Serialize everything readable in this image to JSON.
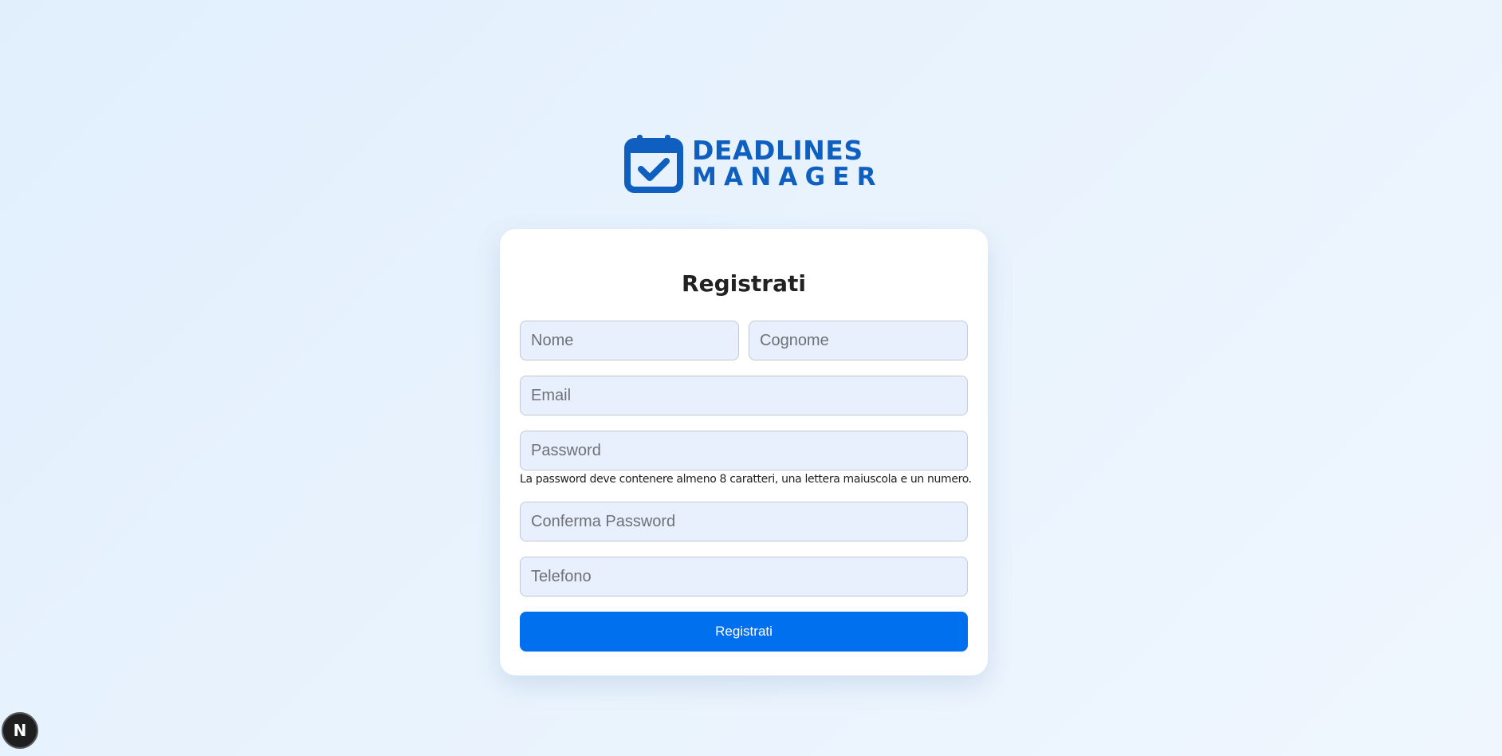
{
  "brand": {
    "line1": "DEADLINES",
    "line2": "MANAGER",
    "icon": "calendar-check-icon",
    "color": "#0e5fc0"
  },
  "form": {
    "title": "Registrati",
    "fields": {
      "nome": {
        "placeholder": "Nome",
        "value": ""
      },
      "cognome": {
        "placeholder": "Cognome",
        "value": ""
      },
      "email": {
        "placeholder": "Email",
        "value": ""
      },
      "password": {
        "placeholder": "Password",
        "value": ""
      },
      "conferma_password": {
        "placeholder": "Conferma Password",
        "value": ""
      },
      "telefono": {
        "placeholder": "Telefono",
        "value": ""
      }
    },
    "password_hint": "La password deve contenere almeno 8 caratteri, una lettera maiuscola e un numero.",
    "submit_label": "Registrati",
    "accent_color": "#0070ef"
  },
  "dev_badge": {
    "label": "N",
    "icon": "nextjs-icon"
  }
}
